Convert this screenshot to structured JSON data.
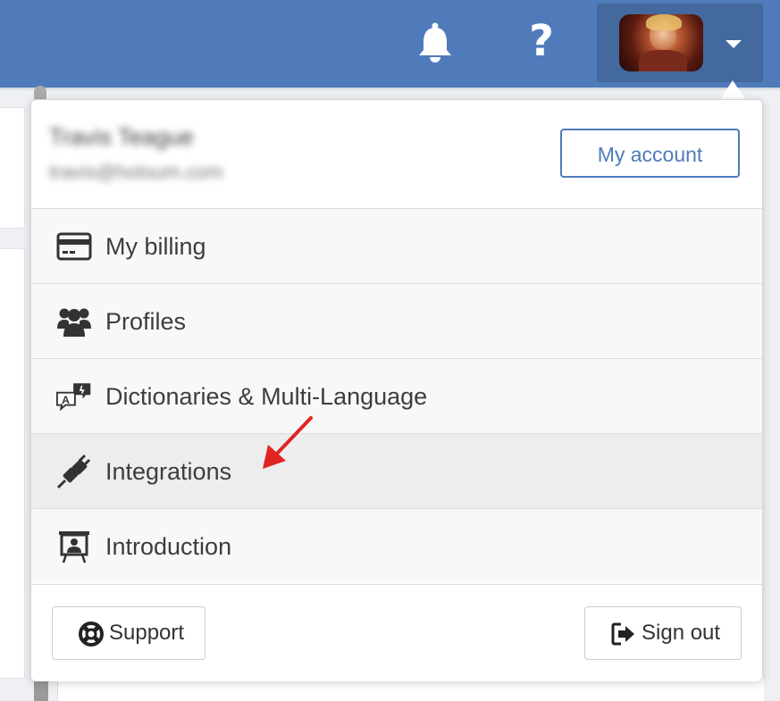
{
  "topbar": {
    "icons": {
      "notifications": "bell-icon",
      "help": "question-icon"
    },
    "help_glyph": "?",
    "user_avatar": "avatar",
    "dropdown_caret": "caret-down-icon"
  },
  "account": {
    "name": "Travis Teague",
    "email": "travis@hotsum.com",
    "my_account_label": "My account"
  },
  "menu": {
    "items": [
      {
        "label": "My billing",
        "icon": "credit-card-icon",
        "active": false
      },
      {
        "label": "Profiles",
        "icon": "users-icon",
        "active": false
      },
      {
        "label": "Dictionaries & Multi-Language",
        "icon": "language-icon",
        "active": false
      },
      {
        "label": "Integrations",
        "icon": "plug-icon",
        "active": true
      },
      {
        "label": "Introduction",
        "icon": "presentation-icon",
        "active": false
      }
    ]
  },
  "footer": {
    "support_label": "Support",
    "support_icon": "lifebuoy-icon",
    "signout_label": "Sign out",
    "signout_icon": "sign-out-icon"
  },
  "colors": {
    "topbar": "#4f7bba",
    "user_trigger": "#44699e",
    "accent": "#4f7bba",
    "annotation_arrow": "#e02424"
  }
}
